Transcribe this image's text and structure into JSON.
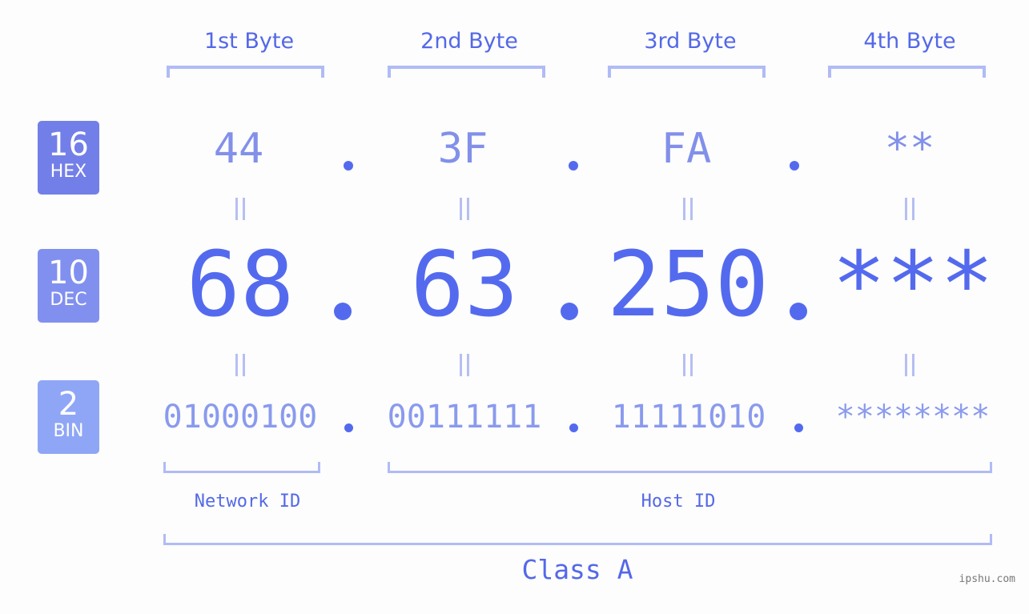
{
  "byte_headers": [
    "1st Byte",
    "2nd Byte",
    "3rd Byte",
    "4th Byte"
  ],
  "rows": {
    "hex": {
      "base": "16",
      "label": "HEX",
      "values": [
        "44",
        "3F",
        "FA",
        "**"
      ],
      "badge_color": "#737fe8"
    },
    "dec": {
      "base": "10",
      "label": "DEC",
      "values": [
        "68",
        "63",
        "250",
        "***"
      ],
      "badge_color": "#8190ef"
    },
    "bin": {
      "base": "2",
      "label": "BIN",
      "values": [
        "01000100",
        "00111111",
        "11111010",
        "********"
      ],
      "badge_color": "#8fa6f6"
    }
  },
  "separator": ".",
  "segments": {
    "network_id": "Network ID",
    "host_id": "Host ID",
    "class": "Class A"
  },
  "watermark": "ipshu.com",
  "colors": {
    "accent": "#546aee",
    "bracket": "#b0bbf6",
    "background": "#fcfdfc"
  }
}
